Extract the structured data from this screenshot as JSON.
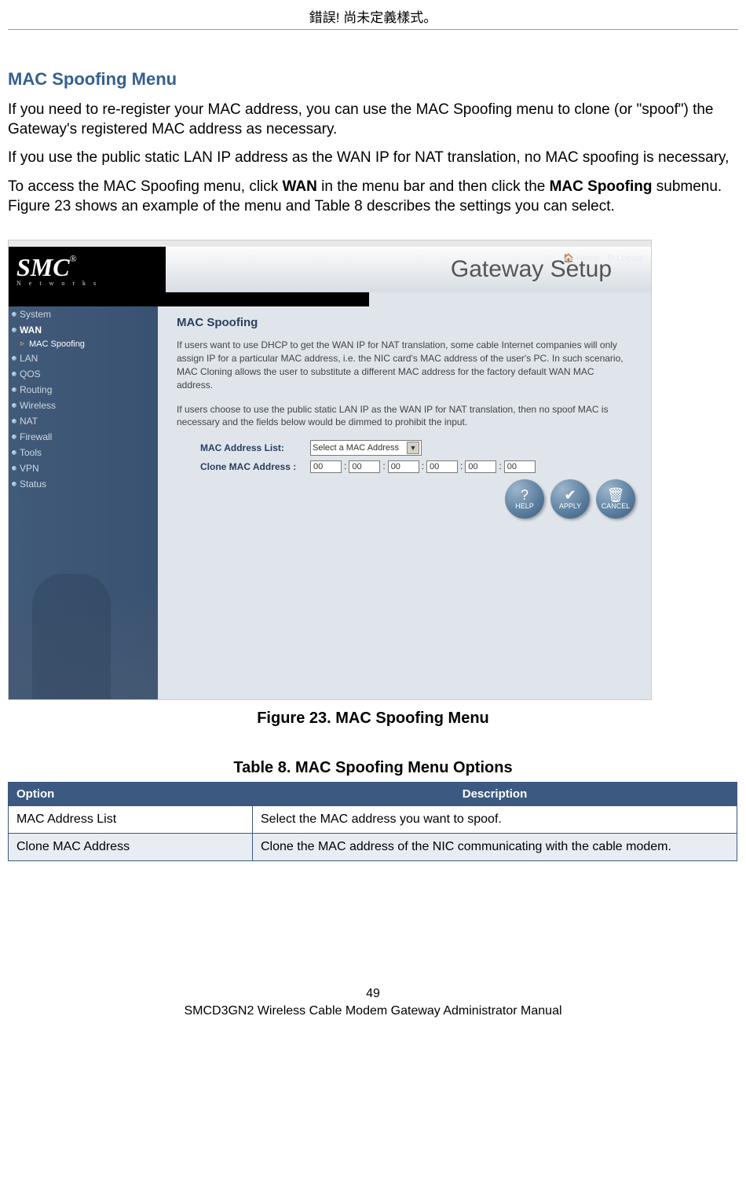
{
  "header_error": "錯誤! 尚未定義樣式。",
  "section_title": "MAC Spoofing Menu",
  "para1": "If you need to re-register your MAC address, you can use the MAC Spoofing menu to clone (or \"spoof\") the Gateway's registered MAC address as necessary.",
  "para2": "If you use the public static LAN IP address as the WAN IP for NAT translation, no MAC spoofing is necessary,",
  "para3_a": "To access the MAC Spoofing menu, click ",
  "para3_b_bold": "WAN",
  "para3_c": " in the menu bar and then click the ",
  "para3_d_bold": "MAC Spoofing",
  "para3_e": " submenu. Figure 23 shows an example of the menu and Table 8 describes the settings you can select.",
  "figure_caption": "Figure 23. MAC Spoofing Menu",
  "table_caption": "Table 8. MAC Spoofing Menu Options",
  "screenshot": {
    "logo_text": "SMC",
    "logo_reg": "®",
    "logo_sub": "N e t w o r k s",
    "title": "Gateway Setup",
    "home_link": "Home",
    "logout_link": "Logout",
    "sidebar": [
      "System",
      "WAN",
      "LAN",
      "QOS",
      "Routing",
      "Wireless",
      "NAT",
      "Firewall",
      "Tools",
      "VPN",
      "Status"
    ],
    "sidebar_sub": "MAC Spoofing",
    "panel_title": "MAC Spoofing",
    "panel_para1": "If users want to use DHCP to get the WAN IP for NAT translation, some cable Internet companies will only assign IP for a particular MAC address, i.e. the NIC card's MAC address of the user's PC. In such scenario, MAC Cloning allows the user to substitute a different MAC address for the factory default WAN MAC address.",
    "panel_para2": "If users choose to use the public static LAN IP as the WAN IP for NAT translation, then no spoof MAC is necessary and the fields below would be dimmed to prohibit the input.",
    "label_mac_list": "MAC Address List:",
    "label_clone": "Clone MAC Address :",
    "select_placeholder": "Select a MAC Address",
    "mac_vals": [
      "00",
      "00",
      "00",
      "00",
      "00",
      "00"
    ],
    "btn_help": "HELP",
    "btn_apply": "APPLY",
    "btn_cancel": "CANCEL"
  },
  "table": {
    "th_option": "Option",
    "th_desc": "Description",
    "rows": [
      {
        "opt": "MAC Address List",
        "desc": "Select the MAC address you want to spoof."
      },
      {
        "opt": "Clone MAC Address",
        "desc": "Clone the MAC address of the NIC communicating with the cable modem."
      }
    ]
  },
  "footer": {
    "page_num": "49",
    "manual": "SMCD3GN2 Wireless Cable Modem Gateway Administrator Manual"
  }
}
